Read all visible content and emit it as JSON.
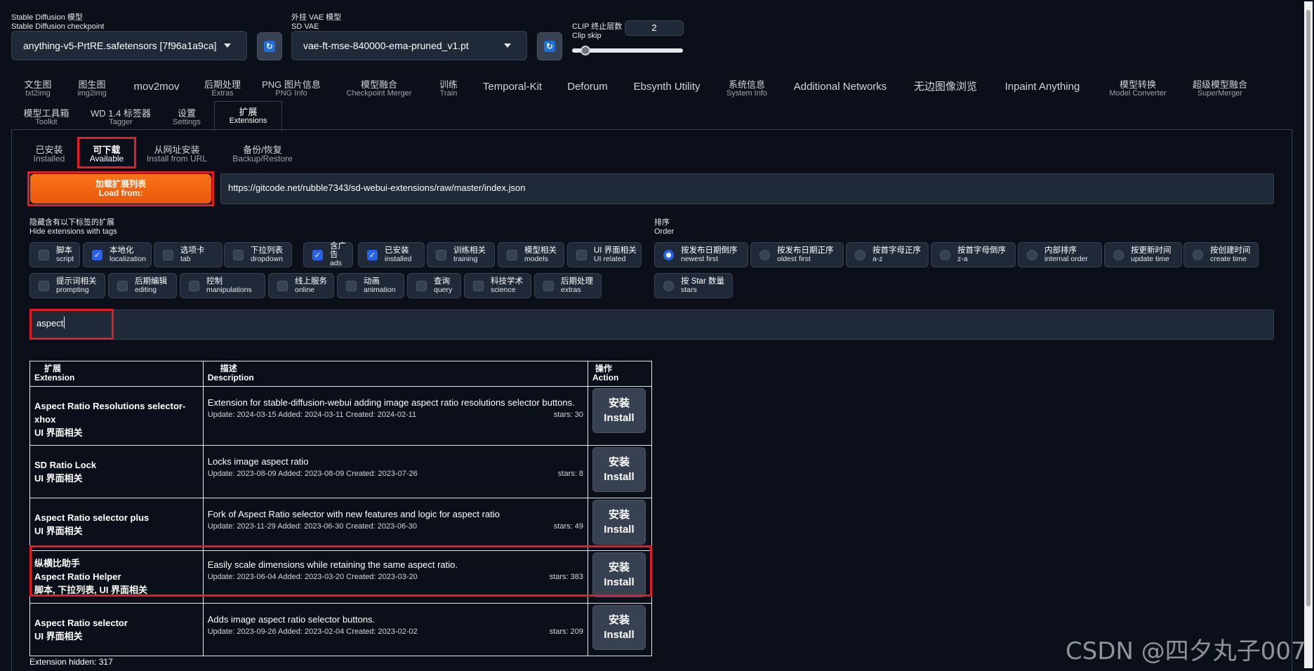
{
  "top": {
    "sd_model_label_zh": "Stable Diffusion 模型",
    "sd_model_label_en": "Stable Diffusion checkpoint",
    "sd_model_value": "anything-v5-PrtRE.safetensors [7f96a1a9ca]",
    "vae_label_zh": "外挂 VAE 模型",
    "vae_label_en": "SD VAE",
    "vae_value": "vae-ft-mse-840000-ema-pruned_v1.pt",
    "clip_label_zh": "CLIP 终止层数",
    "clip_label_en": "Clip skip",
    "clip_value": "2",
    "clip_slider_fraction": 0.08
  },
  "tabs": [
    {
      "zh": "文生图",
      "en": "txt2img"
    },
    {
      "zh": "图生图",
      "en": "img2img"
    },
    {
      "zh": "mov2mov",
      "en": ""
    },
    {
      "zh": "后期处理",
      "en": "Extras"
    },
    {
      "zh": "PNG 图片信息",
      "en": "PNG Info"
    },
    {
      "zh": "模型融合",
      "en": "Checkpoint Merger"
    },
    {
      "zh": "训练",
      "en": "Train"
    },
    {
      "zh": "Temporal-Kit",
      "en": ""
    },
    {
      "zh": "Deforum",
      "en": ""
    },
    {
      "zh": "Ebsynth Utility",
      "en": ""
    },
    {
      "zh": "系统信息",
      "en": "System Info"
    },
    {
      "zh": "Additional Networks",
      "en": ""
    },
    {
      "zh": "无边图像浏览",
      "en": ""
    },
    {
      "zh": "Inpaint Anything",
      "en": ""
    },
    {
      "zh": "模型转换",
      "en": "Model Converter"
    },
    {
      "zh": "超级模型融合",
      "en": "SuperMerger"
    },
    {
      "zh": "模型工具箱",
      "en": "Toolkit"
    },
    {
      "zh": "WD 1.4 标签器",
      "en": "Tagger"
    },
    {
      "zh": "设置",
      "en": "Settings"
    },
    {
      "zh": "扩展",
      "en": "Extensions"
    }
  ],
  "subtabs": [
    {
      "zh": "已安装",
      "en": "Installed"
    },
    {
      "zh": "可下载",
      "en": "Available"
    },
    {
      "zh": "从网址安装",
      "en": "Install from URL"
    },
    {
      "zh": "备份/恢复",
      "en": "Backup/Restore"
    }
  ],
  "load": {
    "button_zh": "加载扩展列表",
    "button_en": "Load from:",
    "url": "https://gitcode.net/rubble7343/sd-webui-extensions/raw/master/index.json"
  },
  "hide": {
    "label_zh": "隐藏含有以下标签的扩展",
    "label_en": "Hide extensions with tags",
    "tags": [
      {
        "zh": "脚本",
        "en": "script",
        "checked": false
      },
      {
        "zh": "本地化",
        "en": "localization",
        "checked": true
      },
      {
        "zh": "选项卡",
        "en": "tab",
        "checked": false
      },
      {
        "zh": "下拉列表",
        "en": "dropdown",
        "checked": false
      },
      {
        "zh": "含广告",
        "en": "ads",
        "checked": true
      },
      {
        "zh": "已安装",
        "en": "installed",
        "checked": true
      },
      {
        "zh": "训练相关",
        "en": "training",
        "checked": false
      },
      {
        "zh": "模型相关",
        "en": "models",
        "checked": false
      },
      {
        "zh": "UI 界面相关",
        "en": "UI related",
        "checked": false
      },
      {
        "zh": "提示词相关",
        "en": "prompting",
        "checked": false
      },
      {
        "zh": "后期编辑",
        "en": "editing",
        "checked": false
      },
      {
        "zh": "控制",
        "en": "manipulations",
        "checked": false
      },
      {
        "zh": "线上服务",
        "en": "online",
        "checked": false
      },
      {
        "zh": "动画",
        "en": "animation",
        "checked": false
      },
      {
        "zh": "查询",
        "en": "query",
        "checked": false
      },
      {
        "zh": "科技学术",
        "en": "science",
        "checked": false
      },
      {
        "zh": "后期处理",
        "en": "extras",
        "checked": false
      }
    ]
  },
  "order": {
    "label_zh": "排序",
    "label_en": "Order",
    "options": [
      {
        "zh": "按发布日期倒序",
        "en": "newest first",
        "selected": true
      },
      {
        "zh": "按发布日期正序",
        "en": "oldest first",
        "selected": false
      },
      {
        "zh": "按首字母正序",
        "en": "a-z",
        "selected": false
      },
      {
        "zh": "按首字母倒序",
        "en": "z-a",
        "selected": false
      },
      {
        "zh": "内部排序",
        "en": "internal order",
        "selected": false
      },
      {
        "zh": "按更新时间",
        "en": "update time",
        "selected": false
      },
      {
        "zh": "按创建时间",
        "en": "create time",
        "selected": false
      },
      {
        "zh": "按 Star 数量",
        "en": "stars",
        "selected": false
      }
    ]
  },
  "search": {
    "value": "aspect"
  },
  "table": {
    "headers": [
      {
        "zh": "扩展",
        "en": "Extension"
      },
      {
        "zh": "描述",
        "en": "Description"
      },
      {
        "zh": "操作",
        "en": "Action"
      }
    ],
    "rows": [
      {
        "name_zh": "",
        "name": "Aspect Ratio Resolutions selector-xhox",
        "tags": "UI 界面相关",
        "desc": "Extension for stable-diffusion-webui adding image aspect ratio resolutions selector buttons.",
        "dates": "Update: 2024-03-15 Added: 2024-03-11 Created: 2024-02-11",
        "stars": "stars: 30",
        "btn_zh": "安装",
        "btn_en": "Install"
      },
      {
        "name_zh": "",
        "name": "SD Ratio Lock",
        "tags": "UI 界面相关",
        "desc": "Locks image aspect ratio",
        "dates": "Update: 2023-08-09 Added: 2023-08-09 Created: 2023-07-26",
        "stars": "stars: 8",
        "btn_zh": "安装",
        "btn_en": "Install"
      },
      {
        "name_zh": "",
        "name": "Aspect Ratio selector plus",
        "tags": "UI 界面相关",
        "desc": "Fork of Aspect Ratio selector with new features and logic for aspect ratio",
        "dates": "Update: 2023-11-29 Added: 2023-06-30 Created: 2023-06-30",
        "stars": "stars: 49",
        "btn_zh": "安装",
        "btn_en": "Install"
      },
      {
        "name_zh": "纵横比助手",
        "name": "Aspect Ratio Helper",
        "tags": "脚本, 下拉列表, UI 界面相关",
        "desc": "Easily scale dimensions while retaining the same aspect ratio.",
        "dates": "Update: 2023-06-04 Added: 2023-03-20 Created: 2023-03-20",
        "stars": "stars: 383",
        "btn_zh": "安装",
        "btn_en": "Install"
      },
      {
        "name_zh": "",
        "name": "Aspect Ratio selector",
        "tags": "UI 界面相关",
        "desc": "Adds image aspect ratio selector buttons.",
        "dates": "Update: 2023-09-26 Added: 2023-02-04 Created: 2023-02-02",
        "stars": "stars: 209",
        "btn_zh": "安装",
        "btn_en": "Install"
      }
    ]
  },
  "footer": {
    "hidden": "Extension hidden: 317"
  },
  "watermark": "CSDN @四夕丸子007",
  "colors": {
    "accent": "#f97316",
    "highlight": "#e11d28",
    "bg": "#0b0f19",
    "checkbox_on": "#2563eb"
  }
}
